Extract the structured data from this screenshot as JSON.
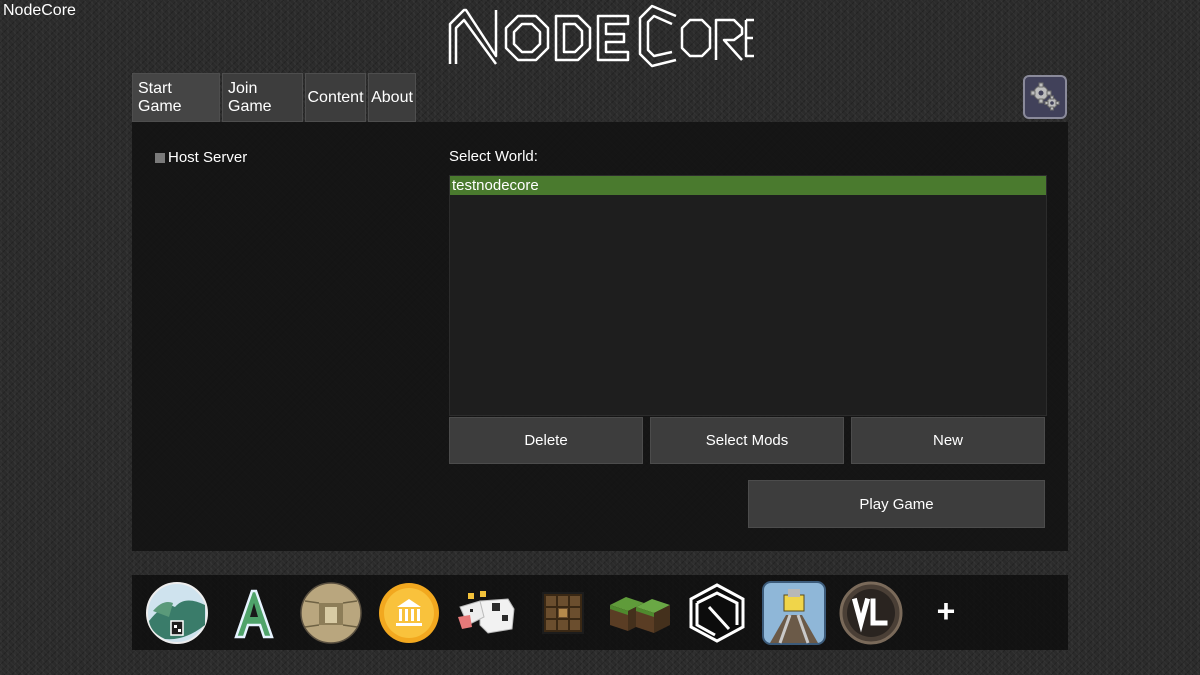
{
  "window": {
    "title": "NodeCore"
  },
  "logo": {
    "text": "NodeCore"
  },
  "tabs": [
    {
      "label": "Start Game",
      "active": true
    },
    {
      "label": "Join Game",
      "active": false
    },
    {
      "label": "Content",
      "active": false
    },
    {
      "label": "About",
      "active": false
    }
  ],
  "settings": {
    "icon": "gears-icon"
  },
  "start_game": {
    "host_server": {
      "label": "Host Server",
      "checked": false
    },
    "select_world_label": "Select World:",
    "worlds": [
      {
        "name": "testnodecore",
        "selected": true
      }
    ],
    "buttons": {
      "delete": "Delete",
      "select_mods": "Select Mods",
      "new": "New",
      "play": "Play Game"
    }
  },
  "games": [
    {
      "icon": "minetest-game-icon"
    },
    {
      "icon": "asuna-icon"
    },
    {
      "icon": "backrooms-icon"
    },
    {
      "icon": "capitalism-coin-icon"
    },
    {
      "icon": "cow-icon"
    },
    {
      "icon": "crate-icon"
    },
    {
      "icon": "grass-blocks-icon"
    },
    {
      "icon": "nodecore-icon"
    },
    {
      "icon": "rail-miner-icon"
    },
    {
      "icon": "voxelibre-icon"
    }
  ],
  "add_game": {
    "label": "+"
  },
  "colors": {
    "selected_world": "#4a7a2e",
    "button": "#3d3d3d",
    "panel": "#121212",
    "settings_bg": "#41415a"
  }
}
